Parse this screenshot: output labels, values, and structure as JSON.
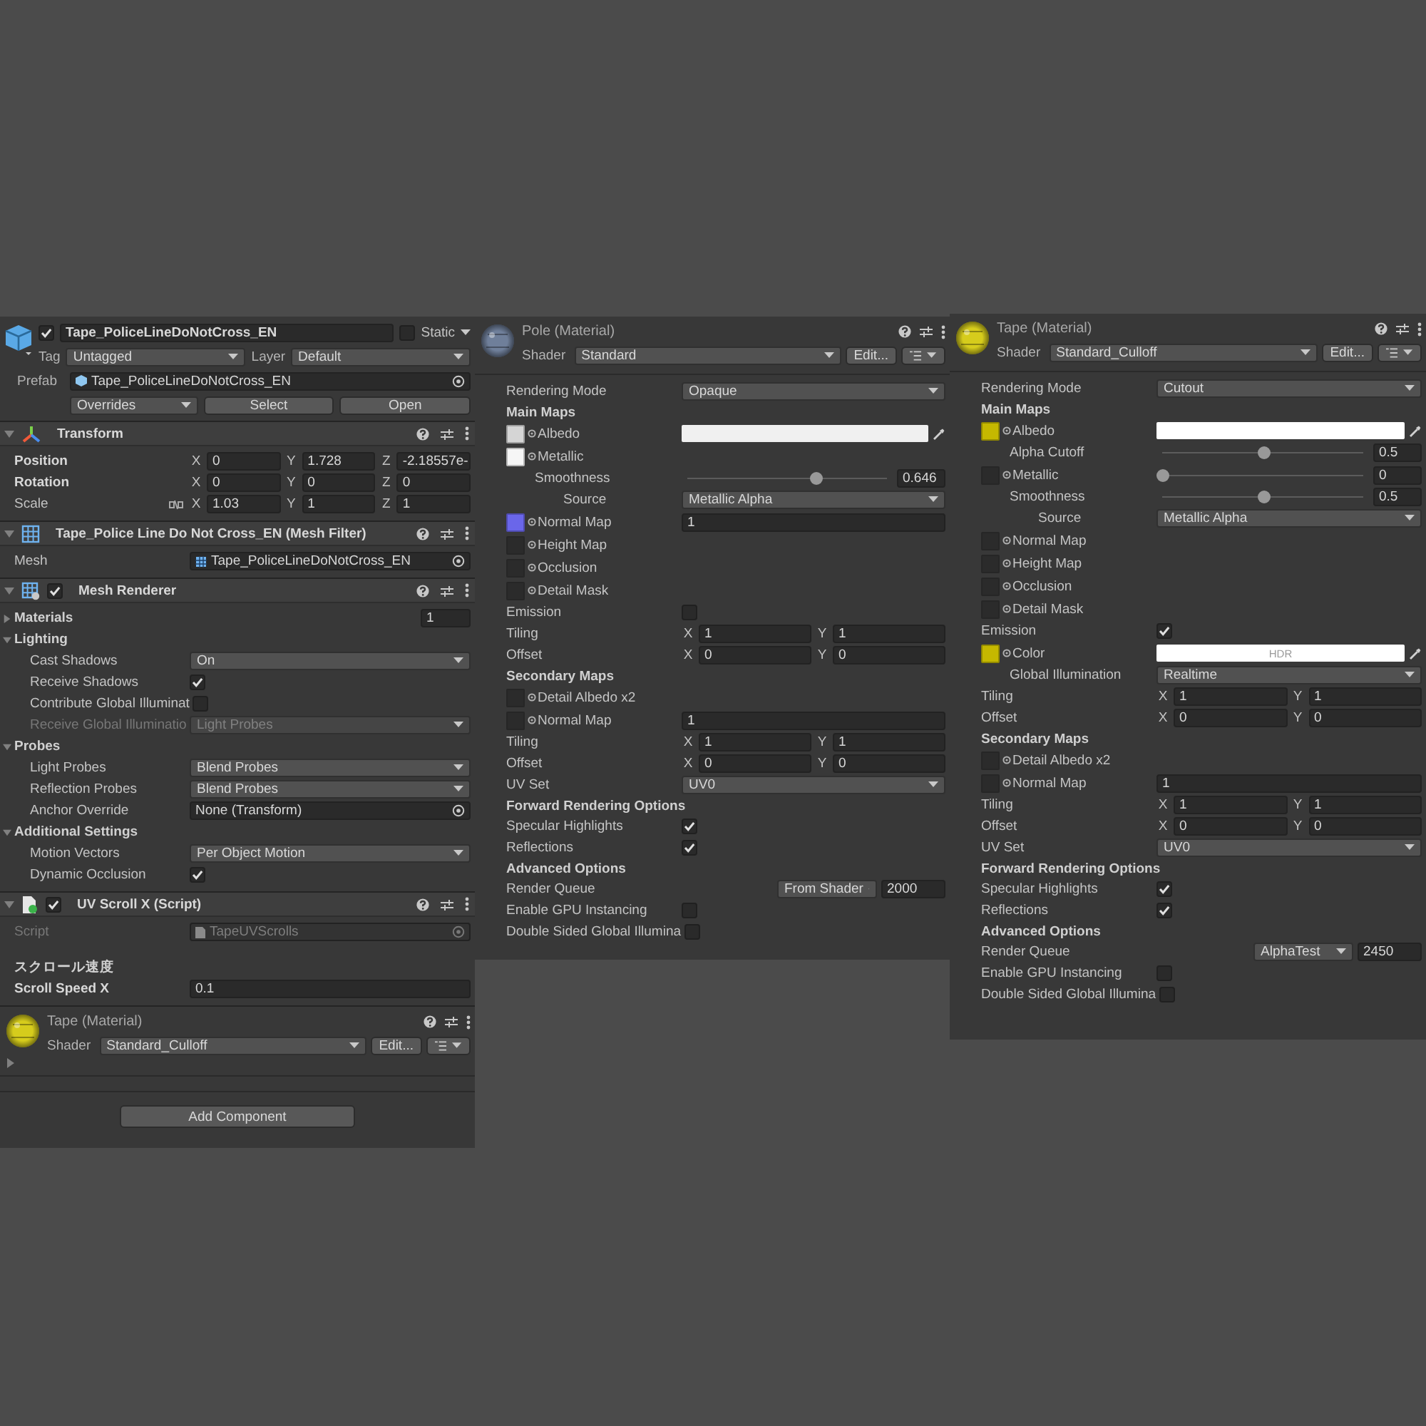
{
  "inspector": {
    "object": {
      "active": true,
      "name": "Tape_PoliceLineDoNotCross_EN",
      "static": false,
      "static_label": "Static",
      "tag_label": "Tag",
      "tag": "Untagged",
      "layer_label": "Layer",
      "layer": "Default",
      "prefab_label": "Prefab",
      "prefab": "Tape_PoliceLineDoNotCross_EN",
      "overrides": "Overrides",
      "select": "Select",
      "open": "Open"
    },
    "components": [
      {
        "kind": "transform",
        "title": "Transform",
        "expanded": true,
        "rows": [
          {
            "kind": "vector",
            "label": "Position",
            "overridden": true,
            "values": [
              {
                "axis": "X",
                "value": "0"
              },
              {
                "axis": "Y",
                "value": "1.728"
              },
              {
                "axis": "Z",
                "value": "-2.18557e-"
              }
            ]
          },
          {
            "kind": "vector",
            "label": "Rotation",
            "overridden": true,
            "values": [
              {
                "axis": "X",
                "value": "0"
              },
              {
                "axis": "Y",
                "value": "0"
              },
              {
                "axis": "Z",
                "value": "0"
              }
            ]
          },
          {
            "kind": "vector",
            "label": "Scale",
            "overridden": false,
            "constrained": false,
            "values": [
              {
                "axis": "X",
                "value": "1.03"
              },
              {
                "axis": "Y",
                "value": "1"
              },
              {
                "axis": "Z",
                "value": "1"
              }
            ]
          }
        ]
      },
      {
        "kind": "mesh-filter",
        "title": "Tape_Police Line Do Not Cross_EN (Mesh Filter)",
        "expanded": true,
        "rows": [
          {
            "kind": "mesh-object",
            "label": "Mesh",
            "value": "Tape_PoliceLineDoNotCross_EN",
            "disabled": false
          }
        ]
      },
      {
        "kind": "mesh-renderer",
        "title": "Mesh Renderer",
        "enabled": true,
        "expanded": true,
        "rows": [
          {
            "kind": "count",
            "label": "Materials",
            "expanded": false,
            "value": "1"
          },
          {
            "kind": "group",
            "label": "Lighting",
            "expanded": true,
            "children": [
              {
                "kind": "dropdown",
                "label": "Cast Shadows",
                "value": "On",
                "disabled": false
              },
              {
                "kind": "checkbox",
                "label": "Receive Shadows",
                "checked": true
              },
              {
                "kind": "checkbox",
                "label": "Contribute Global Illuminat",
                "checked": false
              },
              {
                "kind": "dropdown",
                "label": "Receive Global Illuminatio",
                "value": "Light Probes",
                "disabled": true
              }
            ]
          },
          {
            "kind": "group",
            "label": "Probes",
            "expanded": true,
            "children": [
              {
                "kind": "dropdown",
                "label": "Light Probes",
                "value": "Blend Probes",
                "disabled": false
              },
              {
                "kind": "dropdown",
                "label": "Reflection Probes",
                "value": "Blend Probes",
                "disabled": false
              },
              {
                "kind": "object",
                "label": "Anchor Override",
                "value": "None (Transform)",
                "disabled": false
              }
            ]
          },
          {
            "kind": "group",
            "label": "Additional Settings",
            "expanded": true,
            "children": [
              {
                "kind": "dropdown",
                "label": "Motion Vectors",
                "value": "Per Object Motion",
                "disabled": false
              },
              {
                "kind": "checkbox",
                "label": "Dynamic Occlusion",
                "checked": true
              }
            ]
          }
        ]
      },
      {
        "kind": "script",
        "title": "UV Scroll X (Script)",
        "enabled": true,
        "expanded": true,
        "rows": [
          {
            "kind": "script-object",
            "label": "Script",
            "value": "TapeUVScrolls",
            "disabled": true
          },
          {
            "kind": "heading",
            "label": "スクロール速度"
          },
          {
            "kind": "text",
            "label": "Scroll Speed X",
            "overridden": true,
            "value": "0.1"
          }
        ]
      }
    ],
    "material": {
      "color": "#d6cc1c",
      "title": "Tape (Material)",
      "shader_label": "Shader",
      "shader": "Standard_Culloff",
      "edit": "Edit...",
      "expanded": false
    },
    "add_component": "Add Component"
  },
  "materials": [
    {
      "color": "#6f7f9a",
      "title": "Pole (Material)",
      "shader_label": "Shader",
      "shader": "Standard",
      "edit": "Edit...",
      "rows": [
        {
          "kind": "dropdown",
          "label": "Rendering Mode",
          "value": "Opaque"
        },
        {
          "kind": "heading",
          "label": "Main Maps"
        },
        {
          "kind": "texture",
          "label": "Albedo",
          "color": "#d5d5d5",
          "control": {
            "kind": "color",
            "color": "#f0f0f0"
          }
        },
        {
          "kind": "texture",
          "label": "Metallic",
          "color": "#f6f6f6",
          "children": [
            {
              "kind": "slider",
              "label": "Smoothness",
              "level": 0.646,
              "value": "0.646",
              "children": [
                {
                  "kind": "dropdown",
                  "label": "Source",
                  "value": "Metallic Alpha"
                }
              ]
            }
          ]
        },
        {
          "kind": "texture",
          "label": "Normal Map",
          "color": "#6a66ea",
          "control": {
            "kind": "number",
            "value": "1"
          }
        },
        {
          "kind": "texture",
          "label": "Height Map"
        },
        {
          "kind": "texture",
          "label": "Occlusion"
        },
        {
          "kind": "texture",
          "label": "Detail Mask"
        },
        {
          "kind": "checkbox",
          "label": "Emission",
          "checked": false
        },
        {
          "kind": "vector",
          "label": "Tiling",
          "values": [
            {
              "axis": "X",
              "value": "1"
            },
            {
              "axis": "Y",
              "value": "1"
            }
          ]
        },
        {
          "kind": "vector",
          "label": "Offset",
          "values": [
            {
              "axis": "X",
              "value": "0"
            },
            {
              "axis": "Y",
              "value": "0"
            }
          ]
        },
        {
          "kind": "heading",
          "label": "Secondary Maps"
        },
        {
          "kind": "texture",
          "label": "Detail Albedo x2"
        },
        {
          "kind": "texture",
          "label": "Normal Map",
          "control": {
            "kind": "number",
            "value": "1"
          }
        },
        {
          "kind": "vector",
          "label": "Tiling",
          "values": [
            {
              "axis": "X",
              "value": "1"
            },
            {
              "axis": "Y",
              "value": "1"
            }
          ]
        },
        {
          "kind": "vector",
          "label": "Offset",
          "values": [
            {
              "axis": "X",
              "value": "0"
            },
            {
              "axis": "Y",
              "value": "0"
            }
          ]
        },
        {
          "kind": "dropdown",
          "label": "UV Set",
          "value": "UV0"
        },
        {
          "kind": "heading",
          "label": "Forward Rendering Options"
        },
        {
          "kind": "checkbox",
          "label": "Specular Highlights",
          "checked": true
        },
        {
          "kind": "checkbox",
          "label": "Reflections",
          "checked": true
        },
        {
          "kind": "heading",
          "label": "Advanced Options"
        },
        {
          "kind": "queue",
          "label": "Render Queue",
          "mode": "From Shader",
          "value": "2000"
        },
        {
          "kind": "checkbox",
          "label": "Enable GPU Instancing",
          "checked": false
        },
        {
          "kind": "checkbox",
          "label": "Double Sided Global Illumina",
          "checked": false
        }
      ]
    },
    {
      "color": "#d6cc1c",
      "title": "Tape (Material)",
      "shader_label": "Shader",
      "shader": "Standard_Culloff",
      "edit": "Edit...",
      "rows": [
        {
          "kind": "dropdown",
          "label": "Rendering Mode",
          "value": "Cutout"
        },
        {
          "kind": "heading",
          "label": "Main Maps"
        },
        {
          "kind": "texture",
          "label": "Albedo",
          "color": "#c5b800",
          "control": {
            "kind": "color",
            "color": "#ffffff"
          },
          "children": [
            {
              "kind": "slider",
              "label": "Alpha Cutoff",
              "level": 0.5,
              "value": "0.5"
            }
          ]
        },
        {
          "kind": "texture",
          "label": "Metallic",
          "control": {
            "kind": "slider",
            "level": 0,
            "value": "0"
          },
          "children": [
            {
              "kind": "slider",
              "label": "Smoothness",
              "level": 0.5,
              "value": "0.5",
              "children": [
                {
                  "kind": "dropdown",
                  "label": "Source",
                  "value": "Metallic Alpha"
                }
              ]
            }
          ]
        },
        {
          "kind": "texture",
          "label": "Normal Map"
        },
        {
          "kind": "texture",
          "label": "Height Map"
        },
        {
          "kind": "texture",
          "label": "Occlusion"
        },
        {
          "kind": "texture",
          "label": "Detail Mask"
        },
        {
          "kind": "checkbox",
          "label": "Emission",
          "checked": true
        },
        {
          "kind": "texture",
          "label": "Color",
          "color": "#c5b800",
          "control": {
            "kind": "color",
            "color": "#ffffff",
            "text": "HDR"
          },
          "children": [
            {
              "kind": "dropdown",
              "label": "Global Illumination",
              "value": "Realtime"
            }
          ]
        },
        {
          "kind": "vector",
          "label": "Tiling",
          "values": [
            {
              "axis": "X",
              "value": "1"
            },
            {
              "axis": "Y",
              "value": "1"
            }
          ]
        },
        {
          "kind": "vector",
          "label": "Offset",
          "values": [
            {
              "axis": "X",
              "value": "0"
            },
            {
              "axis": "Y",
              "value": "0"
            }
          ]
        },
        {
          "kind": "heading",
          "label": "Secondary Maps"
        },
        {
          "kind": "texture",
          "label": "Detail Albedo x2"
        },
        {
          "kind": "texture",
          "label": "Normal Map",
          "control": {
            "kind": "number",
            "value": "1"
          }
        },
        {
          "kind": "vector",
          "label": "Tiling",
          "values": [
            {
              "axis": "X",
              "value": "1"
            },
            {
              "axis": "Y",
              "value": "1"
            }
          ]
        },
        {
          "kind": "vector",
          "label": "Offset",
          "values": [
            {
              "axis": "X",
              "value": "0"
            },
            {
              "axis": "Y",
              "value": "0"
            }
          ]
        },
        {
          "kind": "dropdown",
          "label": "UV Set",
          "value": "UV0"
        },
        {
          "kind": "heading",
          "label": "Forward Rendering Options"
        },
        {
          "kind": "checkbox",
          "label": "Specular Highlights",
          "checked": true
        },
        {
          "kind": "checkbox",
          "label": "Reflections",
          "checked": true
        },
        {
          "kind": "heading",
          "label": "Advanced Options"
        },
        {
          "kind": "queue",
          "label": "Render Queue",
          "mode": "AlphaTest",
          "value": "2450"
        },
        {
          "kind": "checkbox",
          "label": "Enable GPU Instancing",
          "checked": false
        },
        {
          "kind": "checkbox",
          "label": "Double Sided Global Illumina",
          "checked": false
        }
      ]
    }
  ]
}
